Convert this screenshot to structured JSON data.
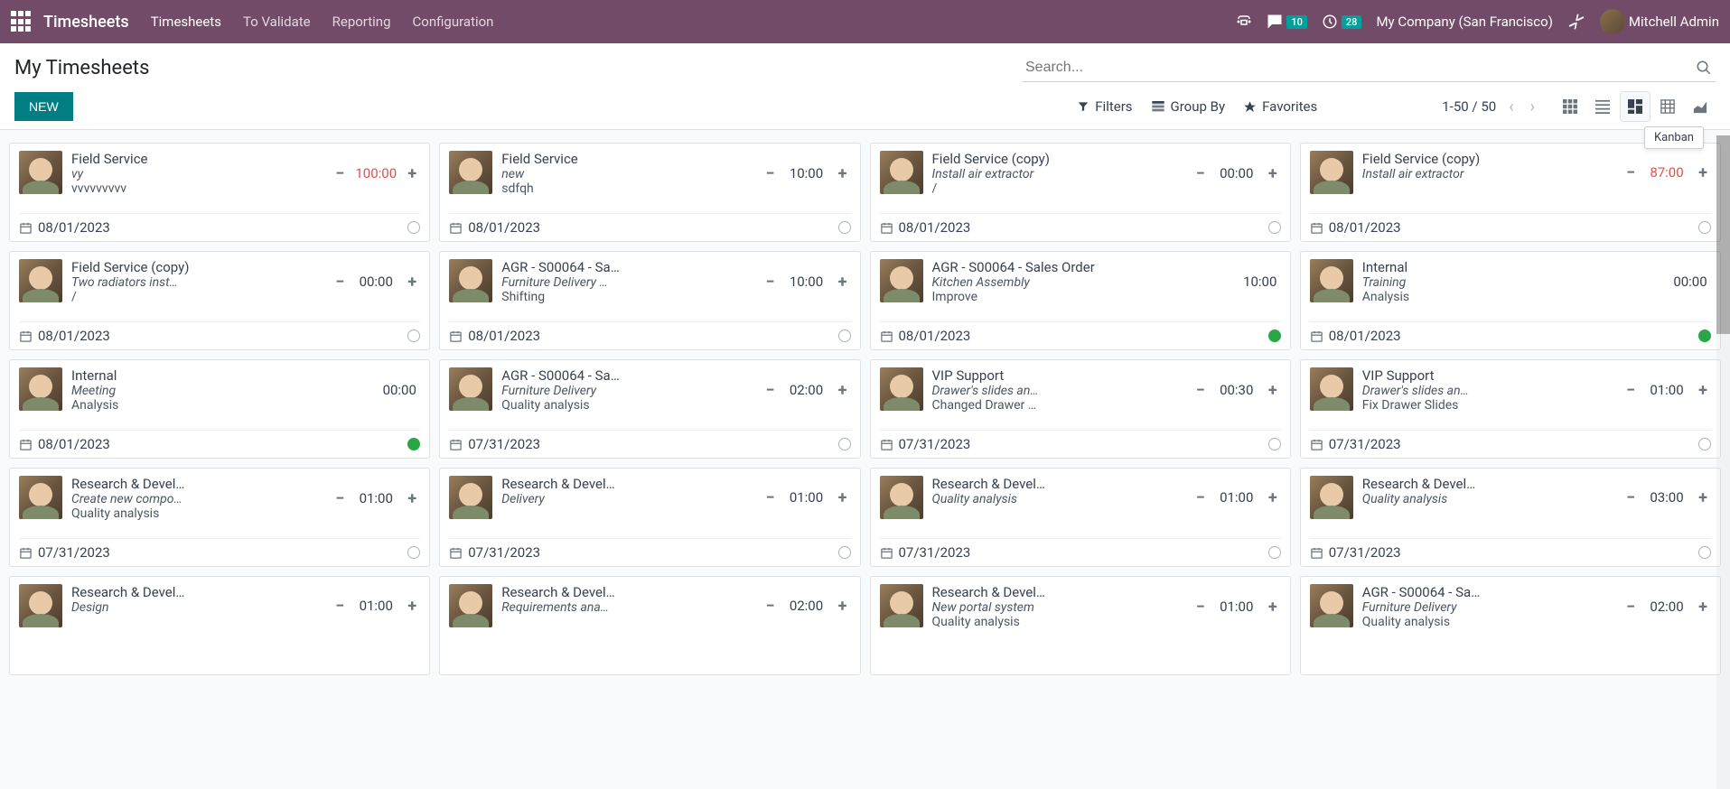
{
  "navbar": {
    "brand": "Timesheets",
    "menu": [
      "Timesheets",
      "To Validate",
      "Reporting",
      "Configuration"
    ],
    "messaging_badge": "10",
    "activities_badge": "28",
    "company": "My Company (San Francisco)",
    "user": "Mitchell Admin"
  },
  "control": {
    "breadcrumb": "My Timesheets",
    "new_label": "NEW",
    "search_placeholder": "Search...",
    "filters_label": "Filters",
    "groupby_label": "Group By",
    "favorites_label": "Favorites",
    "pager": "1-50 / 50",
    "tooltip": "Kanban"
  },
  "cards": [
    {
      "title": "Field Service",
      "subtitle": "vy",
      "desc": "vvvvvvvvv",
      "time": "100:00",
      "time_red": true,
      "date": "08/01/2023",
      "status": "none",
      "controls": true
    },
    {
      "title": "Field Service",
      "subtitle": "new",
      "desc": "sdfqh",
      "time": "10:00",
      "time_red": false,
      "date": "08/01/2023",
      "status": "none",
      "controls": true
    },
    {
      "title": "Field Service (copy)",
      "subtitle": "Install air extractor",
      "desc": "/",
      "time": "00:00",
      "time_red": false,
      "date": "08/01/2023",
      "status": "none",
      "controls": true
    },
    {
      "title": "Field Service (copy)",
      "subtitle": "Install air extractor",
      "desc": "",
      "time": "87:00",
      "time_red": true,
      "date": "08/01/2023",
      "status": "none",
      "controls": true
    },
    {
      "title": "Field Service (copy)",
      "subtitle": "Two radiators inst…",
      "desc": "/",
      "time": "00:00",
      "time_red": false,
      "date": "08/01/2023",
      "status": "none",
      "controls": true
    },
    {
      "title": "AGR - S00064 - Sa…",
      "subtitle": "Furniture Delivery …",
      "desc": "Shifting",
      "time": "10:00",
      "time_red": false,
      "date": "08/01/2023",
      "status": "none",
      "controls": true
    },
    {
      "title": "AGR - S00064 - Sales Order",
      "subtitle": "Kitchen Assembly",
      "desc": "Improve",
      "time": "10:00",
      "time_red": false,
      "date": "08/01/2023",
      "status": "green",
      "controls": false
    },
    {
      "title": "Internal",
      "subtitle": "Training",
      "desc": "Analysis",
      "time": "00:00",
      "time_red": false,
      "date": "08/01/2023",
      "status": "green",
      "controls": false
    },
    {
      "title": "Internal",
      "subtitle": "Meeting",
      "desc": "Analysis",
      "time": "00:00",
      "time_red": false,
      "date": "08/01/2023",
      "status": "green",
      "controls": false
    },
    {
      "title": "AGR - S00064 - Sa…",
      "subtitle": "Furniture Delivery",
      "desc": "Quality analysis",
      "time": "02:00",
      "time_red": false,
      "date": "07/31/2023",
      "status": "none",
      "controls": true
    },
    {
      "title": "VIP Support",
      "subtitle": "Drawer's slides an…",
      "desc": "Changed Drawer …",
      "time": "00:30",
      "time_red": false,
      "date": "07/31/2023",
      "status": "none",
      "controls": true
    },
    {
      "title": "VIP Support",
      "subtitle": "Drawer's slides an…",
      "desc": "Fix Drawer Slides",
      "time": "01:00",
      "time_red": false,
      "date": "07/31/2023",
      "status": "none",
      "controls": true
    },
    {
      "title": "Research & Devel…",
      "subtitle": "Create new compo…",
      "desc": "Quality analysis",
      "time": "01:00",
      "time_red": false,
      "date": "07/31/2023",
      "status": "none",
      "controls": true
    },
    {
      "title": "Research & Devel…",
      "subtitle": "Delivery",
      "desc": "",
      "time": "01:00",
      "time_red": false,
      "date": "07/31/2023",
      "status": "none",
      "controls": true
    },
    {
      "title": "Research & Devel…",
      "subtitle": "Quality analysis",
      "desc": "",
      "time": "01:00",
      "time_red": false,
      "date": "07/31/2023",
      "status": "none",
      "controls": true
    },
    {
      "title": "Research & Devel…",
      "subtitle": "Quality analysis",
      "desc": "",
      "time": "03:00",
      "time_red": false,
      "date": "07/31/2023",
      "status": "none",
      "controls": true
    },
    {
      "title": "Research & Devel…",
      "subtitle": "Design",
      "desc": "",
      "time": "01:00",
      "time_red": false,
      "date": "",
      "status": "",
      "controls": true,
      "partial": true
    },
    {
      "title": "Research & Devel…",
      "subtitle": "Requirements ana…",
      "desc": "",
      "time": "02:00",
      "time_red": false,
      "date": "",
      "status": "",
      "controls": true,
      "partial": true
    },
    {
      "title": "Research & Devel…",
      "subtitle": "New portal system",
      "desc": "Quality analysis",
      "time": "01:00",
      "time_red": false,
      "date": "",
      "status": "",
      "controls": true,
      "partial": true
    },
    {
      "title": "AGR - S00064 - Sa…",
      "subtitle": "Furniture Delivery",
      "desc": "Quality analysis",
      "time": "02:00",
      "time_red": false,
      "date": "",
      "status": "",
      "controls": true,
      "partial": true
    }
  ]
}
